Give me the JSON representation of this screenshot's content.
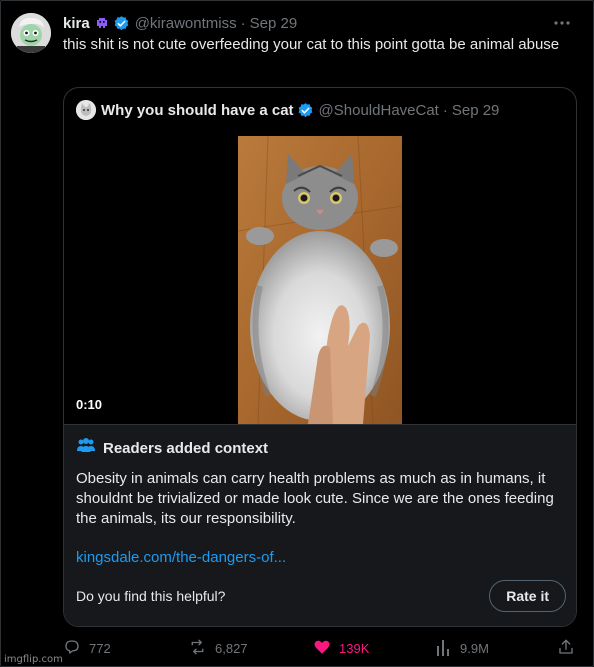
{
  "tweet": {
    "author_name": "kira",
    "author_handle": "@kirawontmiss",
    "separator": "·",
    "date": "Sep 29",
    "text": "this shit is not cute overfeeding your cat to this point gotta be animal abuse",
    "more_icon": "more-dots-icon",
    "name_emoji_icon": "purple-invader-emoji-icon",
    "verified_icon": "verified-badge-icon"
  },
  "quote": {
    "author_name": "Why you should have a cat",
    "author_handle": "@ShouldHaveCat",
    "separator": "·",
    "date": "Sep 29",
    "video_duration": "0:10"
  },
  "context": {
    "title": "Readers added context",
    "body": "Obesity in animals can carry health problems as much as in humans, it shouldnt be trivialized or made look cute. Since we are the ones feeding the animals, its our responsibility.",
    "link": "kingsdale.com/the-dangers-of...",
    "question": "Do you find this helpful?",
    "rate_label": "Rate it"
  },
  "actions": {
    "replies": "772",
    "reposts": "6,827",
    "likes": "139K",
    "views": "9.9M",
    "liked": true,
    "like_color": "#f91880"
  },
  "colors": {
    "background": "#000000",
    "link": "#1d9bf0",
    "verified": "#1d9bf0",
    "muted": "#71767b"
  },
  "watermark": "imgflip.com"
}
